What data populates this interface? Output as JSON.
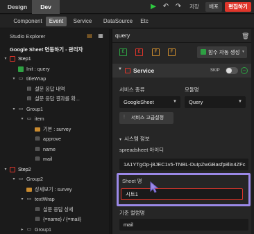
{
  "topbar": {
    "tabs": [
      "Design",
      "Dev"
    ],
    "save": "저장",
    "deploy": "배포",
    "edit": "편집하기"
  },
  "subtabs": [
    "Component",
    "Event",
    "Service",
    "DataSource",
    "Etc"
  ],
  "explorer": {
    "title": "Studio Explorer",
    "sheet_title": "Google Sheet 연동하기 - 관리자",
    "tree": [
      {
        "label": "Step1",
        "level": 0,
        "icon": "event",
        "arrow": "▾"
      },
      {
        "label": "Init : query",
        "level": 1,
        "icon": "green",
        "arrow": ""
      },
      {
        "label": "titleWrap",
        "level": 1,
        "icon": "box",
        "arrow": "▾"
      },
      {
        "label": "설문 응답 내역",
        "level": 2,
        "icon": "text",
        "arrow": ""
      },
      {
        "label": "설문 응답 결과를 확...",
        "level": 2,
        "icon": "text",
        "arrow": ""
      },
      {
        "label": "Group1",
        "level": 1,
        "icon": "box",
        "arrow": "▾"
      },
      {
        "label": "item",
        "level": 2,
        "icon": "box",
        "arrow": "▾"
      },
      {
        "label": "기본 : survey",
        "level": 3,
        "icon": "folder",
        "arrow": ""
      },
      {
        "label": "approve",
        "level": 3,
        "icon": "text",
        "arrow": ""
      },
      {
        "label": "name",
        "level": 3,
        "icon": "text",
        "arrow": ""
      },
      {
        "label": "mail",
        "level": 3,
        "icon": "text",
        "arrow": ""
      },
      {
        "label": "Step2",
        "level": 0,
        "icon": "event",
        "arrow": "▾"
      },
      {
        "label": "Group2",
        "level": 1,
        "icon": "box",
        "arrow": "▾"
      },
      {
        "label": "상세보기 : survey",
        "level": 2,
        "icon": "folder",
        "arrow": ""
      },
      {
        "label": "textWrap",
        "level": 2,
        "icon": "box",
        "arrow": "▾"
      },
      {
        "label": "설문 응답 상세",
        "level": 3,
        "icon": "text",
        "arrow": ""
      },
      {
        "label": "{=name} / {=mail}",
        "level": 3,
        "icon": "text",
        "arrow": ""
      },
      {
        "label": "Group1",
        "level": 2,
        "icon": "box",
        "arrow": "▸"
      }
    ]
  },
  "editor": {
    "query_name": "query",
    "tool_icons": [
      "E",
      "E",
      "F",
      "F"
    ],
    "auto_generate": "함수 자동 생성",
    "service_title": "Service",
    "skip_label": "SKIP",
    "service_type_label": "서비스 종류",
    "module_label": "모듈명",
    "service_type_value": "GoogleSheet",
    "module_value": "Query",
    "advanced_button": "서비스 고급설정",
    "system_info": "시스템 정보",
    "spreadsheet_id_label": "spreadsheet 아이디",
    "spreadsheet_id_value": "1A1YTgOp-j8JEC1v5-TNBL-DuIpZwGBasfp8lin4ZFc",
    "sheet_name_label": "Sheet 명",
    "sheet_name_value": "시트1",
    "criteria_label": "기준 컬럼명",
    "criteria_value": "mail"
  },
  "colors": {
    "accent_red": "#e0362b",
    "green": "#2ea043",
    "highlight": "#9b89e8"
  }
}
